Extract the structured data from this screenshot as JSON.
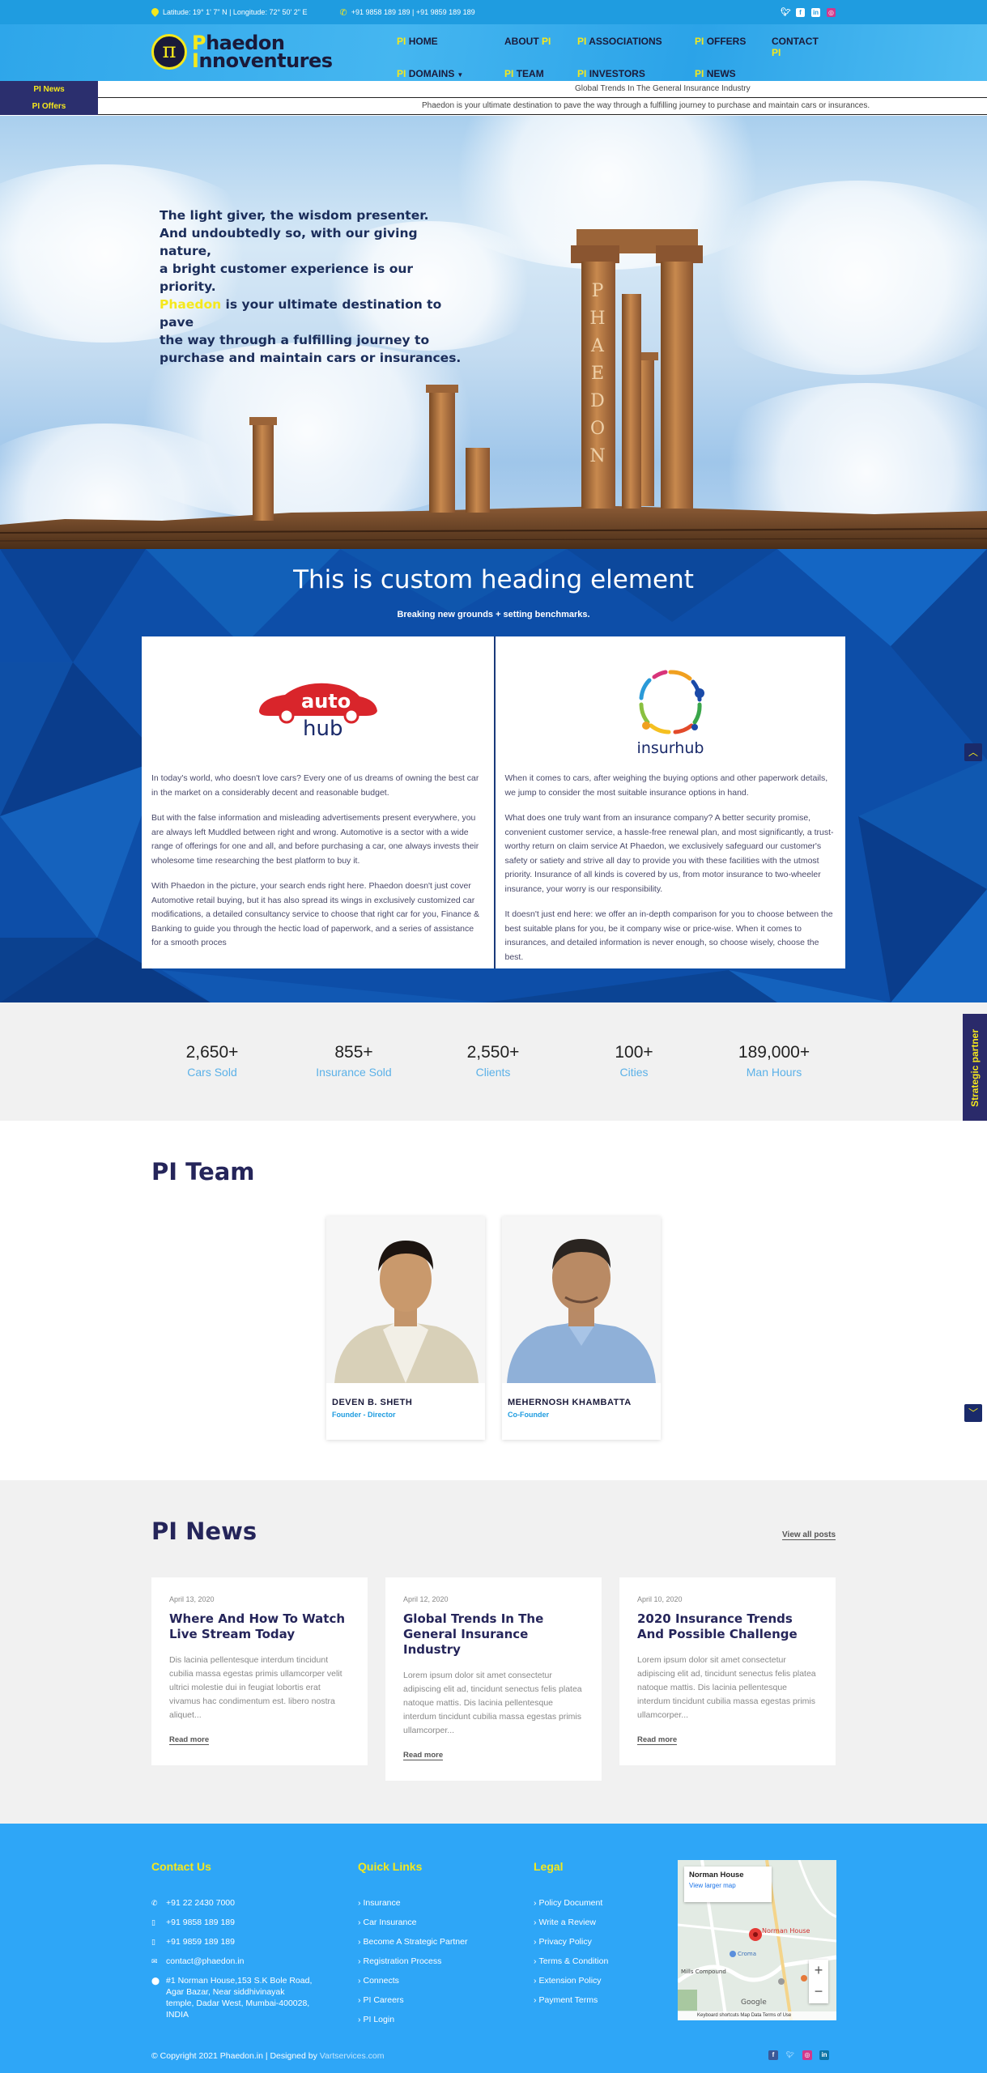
{
  "topbar": {
    "coordinates": "Latitude: 19° 1' 7\" N | Longitude: 72° 50' 2\" E",
    "phones": "+91 9858 189 189 | +91 9859 189 189",
    "social_icons": [
      "twitter-icon",
      "facebook-icon",
      "linkedin-icon",
      "instagram-icon"
    ]
  },
  "logo": {
    "line1": "Phaedon",
    "line2": "Innoventures",
    "symbol": "π"
  },
  "nav": {
    "prefix": "PI",
    "items": [
      {
        "label": "HOME",
        "has_prefix": true
      },
      {
        "label": "ABOUT",
        "suffix": "PI"
      },
      {
        "label": "ASSOCIATIONS",
        "has_prefix": true
      },
      {
        "label": "OFFERS",
        "has_prefix": true
      },
      {
        "label": "CONTACT",
        "suffix": "PI"
      },
      {
        "label": "DOMAINS",
        "has_prefix": true,
        "dropdown": true
      },
      {
        "label": "TEAM",
        "has_prefix": true
      },
      {
        "label": "INVESTORS",
        "has_prefix": true
      },
      {
        "label": "NEWS",
        "has_prefix": true
      }
    ]
  },
  "tickers": {
    "news_label": "PI News",
    "news_text": "Global Trends In The General Insurance Industry",
    "offers_label": "PI Offers",
    "offers_text": "Phaedon is your ultimate destination to pave the way through a fulfilling journey to purchase and maintain cars or insurances."
  },
  "hero": {
    "line1": "The light giver, the wisdom presenter.",
    "line2": "And undoubtedly so, with our giving nature,",
    "line3": "a bright customer experience is our priority.",
    "highlight": "Phaedon",
    "line4_rest": " is your ultimate destination to pave",
    "line5": "the way through a fulfilling journey to",
    "line6": "purchase and maintain cars or insurances.",
    "pillar_text": "PHAEDON"
  },
  "feature": {
    "heading": "This is custom heading element",
    "subheading": "Breaking new grounds + setting benchmarks.",
    "left": {
      "logo_word1": "auto",
      "logo_word2": "hub",
      "paragraphs": [
        "In today's world, who doesn't love cars? Every one of us dreams of owning the best car in the market on a considerably decent and reasonable budget.",
        "But with the false information and misleading advertisements present everywhere, you are always left Muddled between right and wrong. Automotive is a sector with a wide range of offerings for one and all, and before purchasing a car, one always invests their wholesome time researching the best platform to buy it.",
        "With Phaedon in the picture, your search ends right here. Phaedon doesn't just cover Automotive retail buying, but it has also spread its wings in exclusively customized car modifications, a detailed consultancy service to choose that right car for you, Finance & Banking to guide you through the hectic load of paperwork, and a series of assistance for a smooth proces"
      ]
    },
    "right": {
      "logo_word": "insurhub",
      "paragraphs": [
        "When it comes to cars, after weighing the buying options and other paperwork details, we jump to consider the most suitable insurance options in hand.",
        "What does one truly want from an insurance company? A better security promise, convenient customer service, a hassle-free renewal plan, and most significantly, a trust-worthy return on claim service At Phaedon, we exclusively safeguard our customer's safety or satiety and strive all day to provide you with these facilities with the utmost priority. Insurance of all kinds is covered by us, from motor insurance to two-wheeler insurance, your worry is our responsibility.",
        "It doesn't just end here: we offer an in-depth comparison for you to choose between the best suitable plans for you, be it company wise or price-wise. When it comes to insurances, and detailed information is never enough, so choose wisely, choose the best."
      ]
    }
  },
  "stats": [
    {
      "value": "2,650+",
      "label": "Cars Sold"
    },
    {
      "value": "855+",
      "label": "Insurance Sold"
    },
    {
      "value": "2,550+",
      "label": "Clients"
    },
    {
      "value": "100+",
      "label": "Cities"
    },
    {
      "value": "189,000+",
      "label": "Man Hours"
    }
  ],
  "strategic_tab": "Strategic partner",
  "team": {
    "title": "PI Team",
    "members": [
      {
        "name": "DEVEN B. SHETH",
        "role": "Founder - Director"
      },
      {
        "name": "MEHERNOSH KHAMBATTA",
        "role": "Co-Founder"
      }
    ]
  },
  "news": {
    "title": "PI News",
    "view_all": "View all posts",
    "read_more": "Read more",
    "posts": [
      {
        "date": "April 13, 2020",
        "title": "Where And How To Watch Live Stream Today",
        "excerpt": "Dis lacinia pellentesque interdum tincidunt cubilia massa egestas primis ullamcorper velit ultrici molestie dui in feugiat lobortis erat vivamus hac condimentum est. libero nostra aliquet..."
      },
      {
        "date": "April 12, 2020",
        "title": "Global Trends In The General Insurance Industry",
        "excerpt": "Lorem ipsum dolor sit amet consectetur adipiscing elit ad, tincidunt senectus felis platea natoque mattis. Dis lacinia pellentesque interdum tincidunt cubilia massa egestas primis ullamcorper..."
      },
      {
        "date": "April 10, 2020",
        "title": "2020 Insurance Trends And Possible Challenge",
        "excerpt": "Lorem ipsum dolor sit amet consectetur adipiscing elit ad, tincidunt senectus felis platea natoque mattis. Dis lacinia pellentesque interdum tincidunt cubilia massa egestas primis ullamcorper..."
      }
    ]
  },
  "footer": {
    "contact_title": "Contact Us",
    "contact": [
      {
        "icon": "phone-icon",
        "text": "+91 22 2430 7000"
      },
      {
        "icon": "mobile-icon",
        "text": "+91 9858 189 189"
      },
      {
        "icon": "mobile-icon",
        "text": "+91 9859 189 189"
      },
      {
        "icon": "email-icon",
        "text": "contact@phaedon.in"
      },
      {
        "icon": "location-icon",
        "text": "#1 Norman House,153 S.K Bole Road, Agar Bazar, Near siddhivinayak temple, Dadar West, Mumbai-400028, INDIA"
      }
    ],
    "quick_title": "Quick Links",
    "quick_links": [
      "Insurance",
      "Car Insurance",
      "Become A Strategic Partner",
      "Registration Process",
      "Connects",
      "PI Careers",
      "PI Login"
    ],
    "legal_title": "Legal",
    "legal_links": [
      "Policy Document",
      "Write a Review",
      "Privacy Policy",
      "Terms & Condition",
      "Extension Policy",
      "Payment Terms"
    ],
    "map": {
      "place": "Norman House",
      "view_larger": "View larger map",
      "pin_label": "Norman House",
      "labels": [
        "Croma",
        "Mills Compound"
      ],
      "attribution": "Keyboard shortcuts   Map Data   Terms of Use",
      "brand": "Google"
    },
    "copyright_prefix": "© Copyright 2021 Phaedon.in | Designed by ",
    "designer": "Vartservices.com",
    "social_icons": [
      "facebook-icon",
      "twitter-icon",
      "instagram-icon",
      "linkedin-icon"
    ]
  },
  "colors": {
    "brand_yellow": "#f5e81c",
    "brand_navy": "#25255a",
    "sky_blue": "#2ea6f7",
    "deep_blue": "#0d4ea8"
  }
}
